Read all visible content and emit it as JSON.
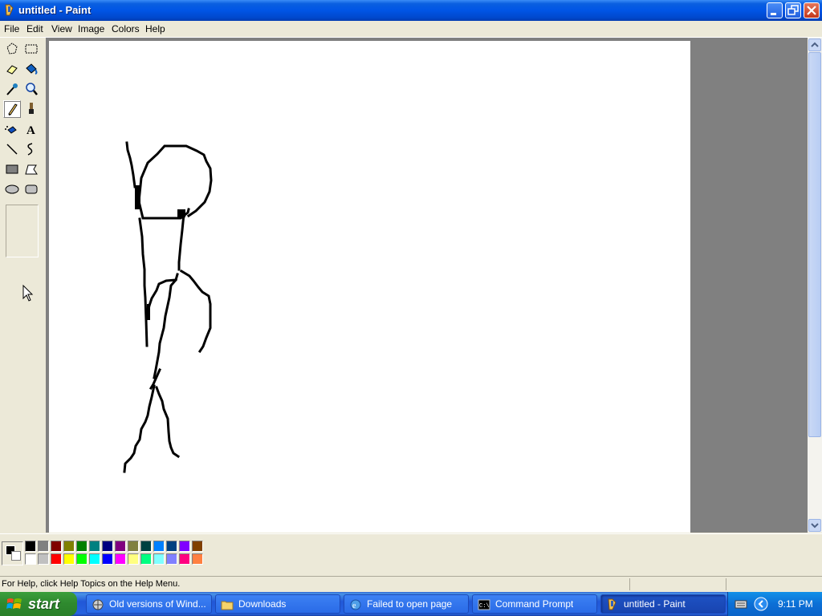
{
  "window": {
    "title": "untitled - Paint"
  },
  "menu": [
    "File",
    "Edit",
    "View",
    "Image",
    "Colors",
    "Help"
  ],
  "tools": [
    {
      "name": "free-select-icon"
    },
    {
      "name": "rect-select-icon"
    },
    {
      "name": "eraser-icon"
    },
    {
      "name": "fill-icon"
    },
    {
      "name": "pick-color-icon"
    },
    {
      "name": "magnifier-icon"
    },
    {
      "name": "pencil-icon",
      "active": true
    },
    {
      "name": "brush-icon"
    },
    {
      "name": "airbrush-icon"
    },
    {
      "name": "text-icon",
      "glyph": "A"
    },
    {
      "name": "line-icon"
    },
    {
      "name": "curve-icon"
    },
    {
      "name": "rectangle-icon"
    },
    {
      "name": "polygon-icon"
    },
    {
      "name": "ellipse-icon"
    },
    {
      "name": "rounded-rect-icon"
    }
  ],
  "colors": {
    "foreground": "#000000",
    "background": "#ffffff",
    "palette_top": [
      "#000000",
      "#808080",
      "#800000",
      "#808000",
      "#008000",
      "#008080",
      "#000080",
      "#800080",
      "#808040",
      "#004040",
      "#0080ff",
      "#004080",
      "#8000ff",
      "#804000"
    ],
    "palette_bottom": [
      "#ffffff",
      "#c0c0c0",
      "#ff0000",
      "#ffff00",
      "#00ff00",
      "#00ffff",
      "#0000ff",
      "#ff00ff",
      "#ffff80",
      "#00ff80",
      "#80ffff",
      "#8080ff",
      "#ff0080",
      "#ff8040"
    ]
  },
  "status": {
    "text": "For Help, click Help Topics on the Help Menu."
  },
  "taskbar": {
    "start_label": "start",
    "tasks": [
      {
        "label": "Old versions of Wind...",
        "icon": "browser-icon",
        "active": false
      },
      {
        "label": "Downloads",
        "icon": "folder-icon",
        "active": false
      },
      {
        "label": "Failed to open page",
        "icon": "ie-icon",
        "active": false
      },
      {
        "label": "Command Prompt",
        "icon": "cmd-icon",
        "active": false
      },
      {
        "label": "untitled - Paint",
        "icon": "paint-icon",
        "active": true
      }
    ],
    "clock": "9:11 PM"
  }
}
